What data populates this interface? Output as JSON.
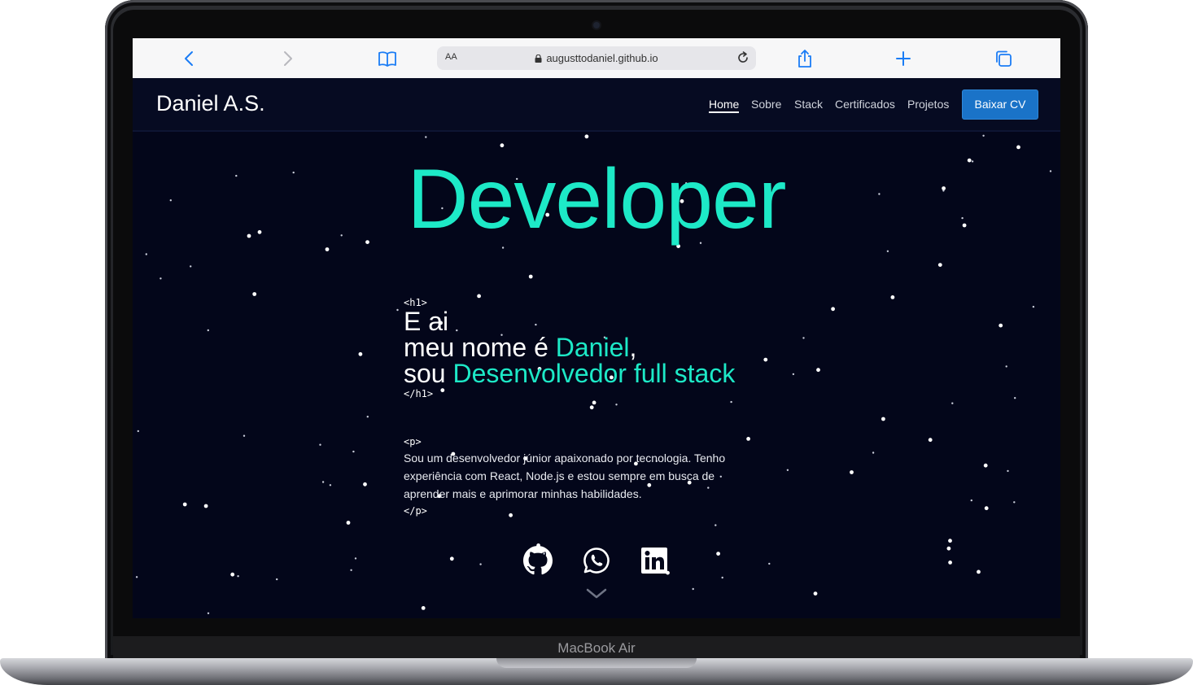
{
  "device": {
    "label": "MacBook Air"
  },
  "browser": {
    "text_size_label": "AA",
    "url": "augusttodaniel.github.io",
    "icons": [
      "back-icon",
      "forward-icon",
      "bookmarks-icon",
      "lock-icon",
      "reload-icon",
      "share-icon",
      "new-tab-icon",
      "tabs-icon"
    ]
  },
  "nav": {
    "brand": "Daniel A.S.",
    "links": [
      "Home",
      "Sobre",
      "Stack",
      "Certificados",
      "Projetos"
    ],
    "active": "Home",
    "cv_button": "Baixar CV"
  },
  "hero": {
    "title": "Developer",
    "h1_open": "<h1>",
    "h1_close": "</h1>",
    "line1": "E ai",
    "line2_prefix": "meu nome é ",
    "line2_name": "Daniel",
    "line2_suffix": ",",
    "line3_prefix": "sou ",
    "line3_role": "Desenvolvedor full stack",
    "p_open": "<p>",
    "p_close": "</p>",
    "paragraph": "Sou um desenvolvedor júnior apaixonado por tecnologia. Tenho experiência com React, Node.js e estou sempre em busca de aprender mais e aprimorar minhas habilidades."
  },
  "social": [
    "github-icon",
    "whatsapp-icon",
    "linkedin-icon"
  ],
  "colors": {
    "accent": "#1de9c7",
    "background": "#03061a",
    "navbar": "#060b22",
    "button": "#1a73c8",
    "safari_blue": "#1a7cf5"
  }
}
